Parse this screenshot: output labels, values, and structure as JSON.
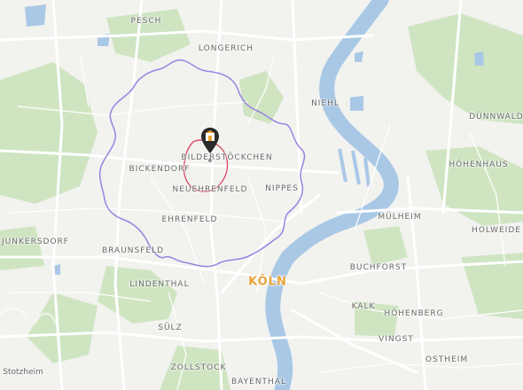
{
  "map": {
    "city_label": "KÖLN",
    "district_labels": [
      {
        "id": "pesch",
        "text": "PESCH"
      },
      {
        "id": "longerich",
        "text": "LONGERICH"
      },
      {
        "id": "niehl",
        "text": "NIEHL"
      },
      {
        "id": "dunnwald",
        "text": "DÜNNWALD"
      },
      {
        "id": "bickendorf",
        "text": "BICKENDORF"
      },
      {
        "id": "bilderstockchen",
        "text": "BILDERSTÖCKCHEN"
      },
      {
        "id": "nippes",
        "text": "NIPPES"
      },
      {
        "id": "hohenhaus",
        "text": "HÖHENHAUS"
      },
      {
        "id": "neuehrenfeld",
        "text": "NEUEHRENFELD"
      },
      {
        "id": "ehrenfeld",
        "text": "EHRENFELD"
      },
      {
        "id": "mulheim",
        "text": "MÜLHEIM"
      },
      {
        "id": "holweide",
        "text": "HOLWEIDE"
      },
      {
        "id": "junkersdorf",
        "text": "JUNKERSDORF"
      },
      {
        "id": "braunsfeld",
        "text": "BRAUNSFELD"
      },
      {
        "id": "buchforst",
        "text": "BUCHFORST"
      },
      {
        "id": "lindenthal",
        "text": "LINDENTHAL"
      },
      {
        "id": "kalk",
        "text": "KALK"
      },
      {
        "id": "hohenberg",
        "text": "HÖHENBERG"
      },
      {
        "id": "sulz",
        "text": "SÜLZ"
      },
      {
        "id": "vingst",
        "text": "VINGST"
      },
      {
        "id": "ostheim",
        "text": "OSTHEIM"
      },
      {
        "id": "zollstock",
        "text": "ZOLLSTOCK"
      },
      {
        "id": "bayenthal",
        "text": "BAYENTHAL"
      },
      {
        "id": "stotzheim",
        "text": "Stotzheim"
      }
    ],
    "colors": {
      "background": "#f2f2ef",
      "water": "#a9c8e6",
      "green": "#cfe5c2",
      "road": "#ffffff",
      "outer_isochrone": "#9b83e0",
      "inner_isochrone": "#d5455f",
      "marker": "#2b2b2b",
      "marker_icon": "#f0a432"
    },
    "marker_icon": "building-icon",
    "isochrones": [
      "outer-travel-area",
      "inner-travel-area"
    ]
  }
}
